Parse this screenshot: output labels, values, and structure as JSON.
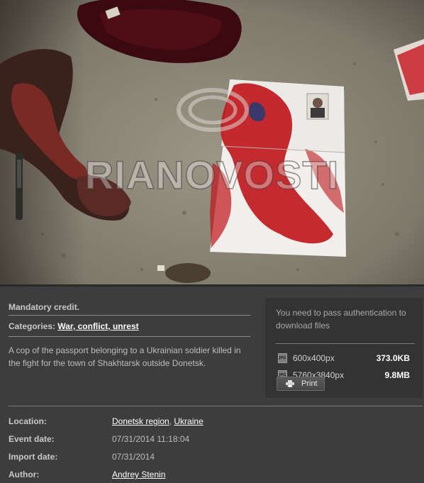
{
  "photo": {
    "watermark": "RIANOVOSTI"
  },
  "info": {
    "mandatory_credit": "Mandatory credit.",
    "categories_label": "Categories:",
    "categories_value": "War, conflict, unrest",
    "description": "A cop of the passport belonging to a Ukrainian soldier killed in the fight for the town of Shakhtarsk outside Donetsk."
  },
  "download": {
    "auth_message": "You need to pass authentication to download files",
    "files": [
      {
        "icon": "jpg-file-icon",
        "dims": "600x400px",
        "size": "373.0KB"
      },
      {
        "icon": "jpg-file-icon",
        "dims": "5760x3840px",
        "size": "9.8MB"
      }
    ],
    "print_label": "Print"
  },
  "meta": {
    "location_label": "Location:",
    "location_region": "Donetsk region",
    "location_country": "Ukraine",
    "event_date_label": "Event date:",
    "event_date": "07/31/2014 11:18:04",
    "import_date_label": "Import date:",
    "import_date": "07/31/2014",
    "author_label": "Author:",
    "author": "Andrey Stenin"
  },
  "colors": {
    "panel_bg": "#3d3d3d",
    "auth_box_bg": "#333333",
    "link": "#ffffff",
    "blood_red": "#c0141a"
  }
}
